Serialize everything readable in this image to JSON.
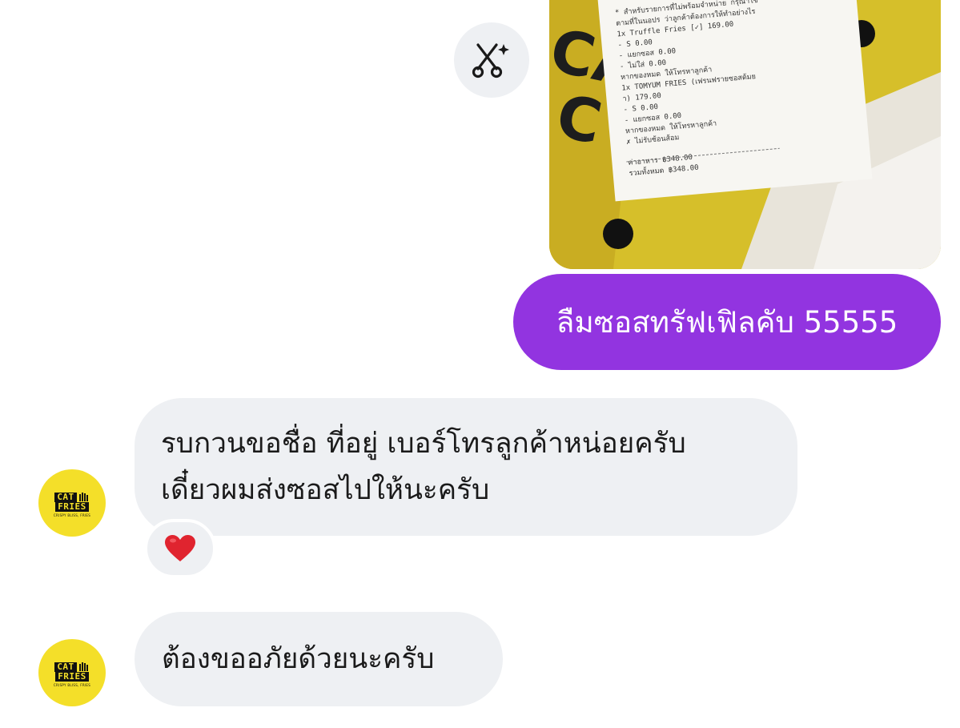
{
  "conversation": {
    "photo": {
      "receipt_lines": [
        "* สำหรับรายการที่ไม่พร้อมจำหน่าย กรุณาใช้",
        "ตามที่ในนอปร ว่าลูกค้าต้องการให้ทำอย่างไร",
        "1x   Truffle Fries [✓]      169.00",
        "  - S    0.00",
        "  - แยกซอส    0.00",
        "  - ไม่ใส่    0.00",
        "  หากของหมด ให้โทรหาลูกค้า",
        "1x   TOMYUM FRIES (เฟรนฟรายซอสต้มย",
        " า)    179.00",
        "  - S    0.00",
        "  - แยกซอส    0.00",
        "  หากของหมด ให้โทรหาลูกค้า",
        "✗ ไม่รับช้อนส้อม",
        "ค่าอาหาร   ฿348.00",
        "รวมทั้งหมด  ฿348.00"
      ]
    },
    "outgoing_message": "ลืมซอสทรัฟเฟิลคับ 55555",
    "incoming_messages": [
      {
        "lines": [
          "รบกวนขอชื่อ ที่อยู่ เบอร์โทรลูกค้าหน่อยครับ",
          "เดี๋ยวผมส่งซอสไปให้นะครับ"
        ],
        "reaction": "❤️"
      },
      {
        "lines": [
          "ต้องขออภัยด้วยนะครับ"
        ]
      }
    ],
    "avatar": {
      "line1": "CAT",
      "line2": "FRIES",
      "tagline": "CRISPY BLISS, FRIES"
    }
  },
  "colors": {
    "outgoing_bubble": "#9234e0",
    "incoming_bubble": "#eef0f3",
    "avatar_background": "#f4df29",
    "heart": "#e0242f"
  },
  "icons": {
    "edit_button": "scissors-sparkle-icon",
    "reaction": "heart-icon"
  }
}
